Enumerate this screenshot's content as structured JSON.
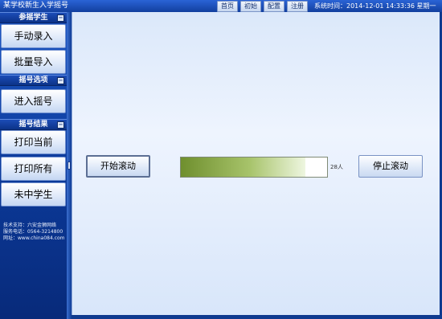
{
  "window": {
    "title": "某学校新生入学摇号"
  },
  "topnav": {
    "home": "首页",
    "init": "初始",
    "config": "配置",
    "logout": "注册"
  },
  "status": {
    "system_time": "系统时间：2014-12-01 14:33:36 星期一"
  },
  "sidebar": {
    "sections": [
      {
        "title": "参摇学生",
        "buttons": [
          "手动录入",
          "批量导入"
        ]
      },
      {
        "title": "摇号选项",
        "buttons": [
          "进入摇号"
        ]
      },
      {
        "title": "摇号结果",
        "buttons": [
          "打印当前",
          "打印所有",
          "未中学生"
        ]
      }
    ],
    "collapse_icon": "minus-icon",
    "support": {
      "line1": "技术支持：六安金狮网络",
      "line2": "服务电话：0564-3214800",
      "line3": "网址：www.china084.com"
    }
  },
  "main": {
    "start_label": "开始滚动",
    "stop_label": "停止滚动",
    "count_text": "28人",
    "roller_progress": 0.85
  },
  "colors": {
    "frame": "#0e3a8f",
    "sidebar": "#1c56c4",
    "main_bg": "#dbe8fa",
    "bar_green": "#6f8f2e"
  }
}
